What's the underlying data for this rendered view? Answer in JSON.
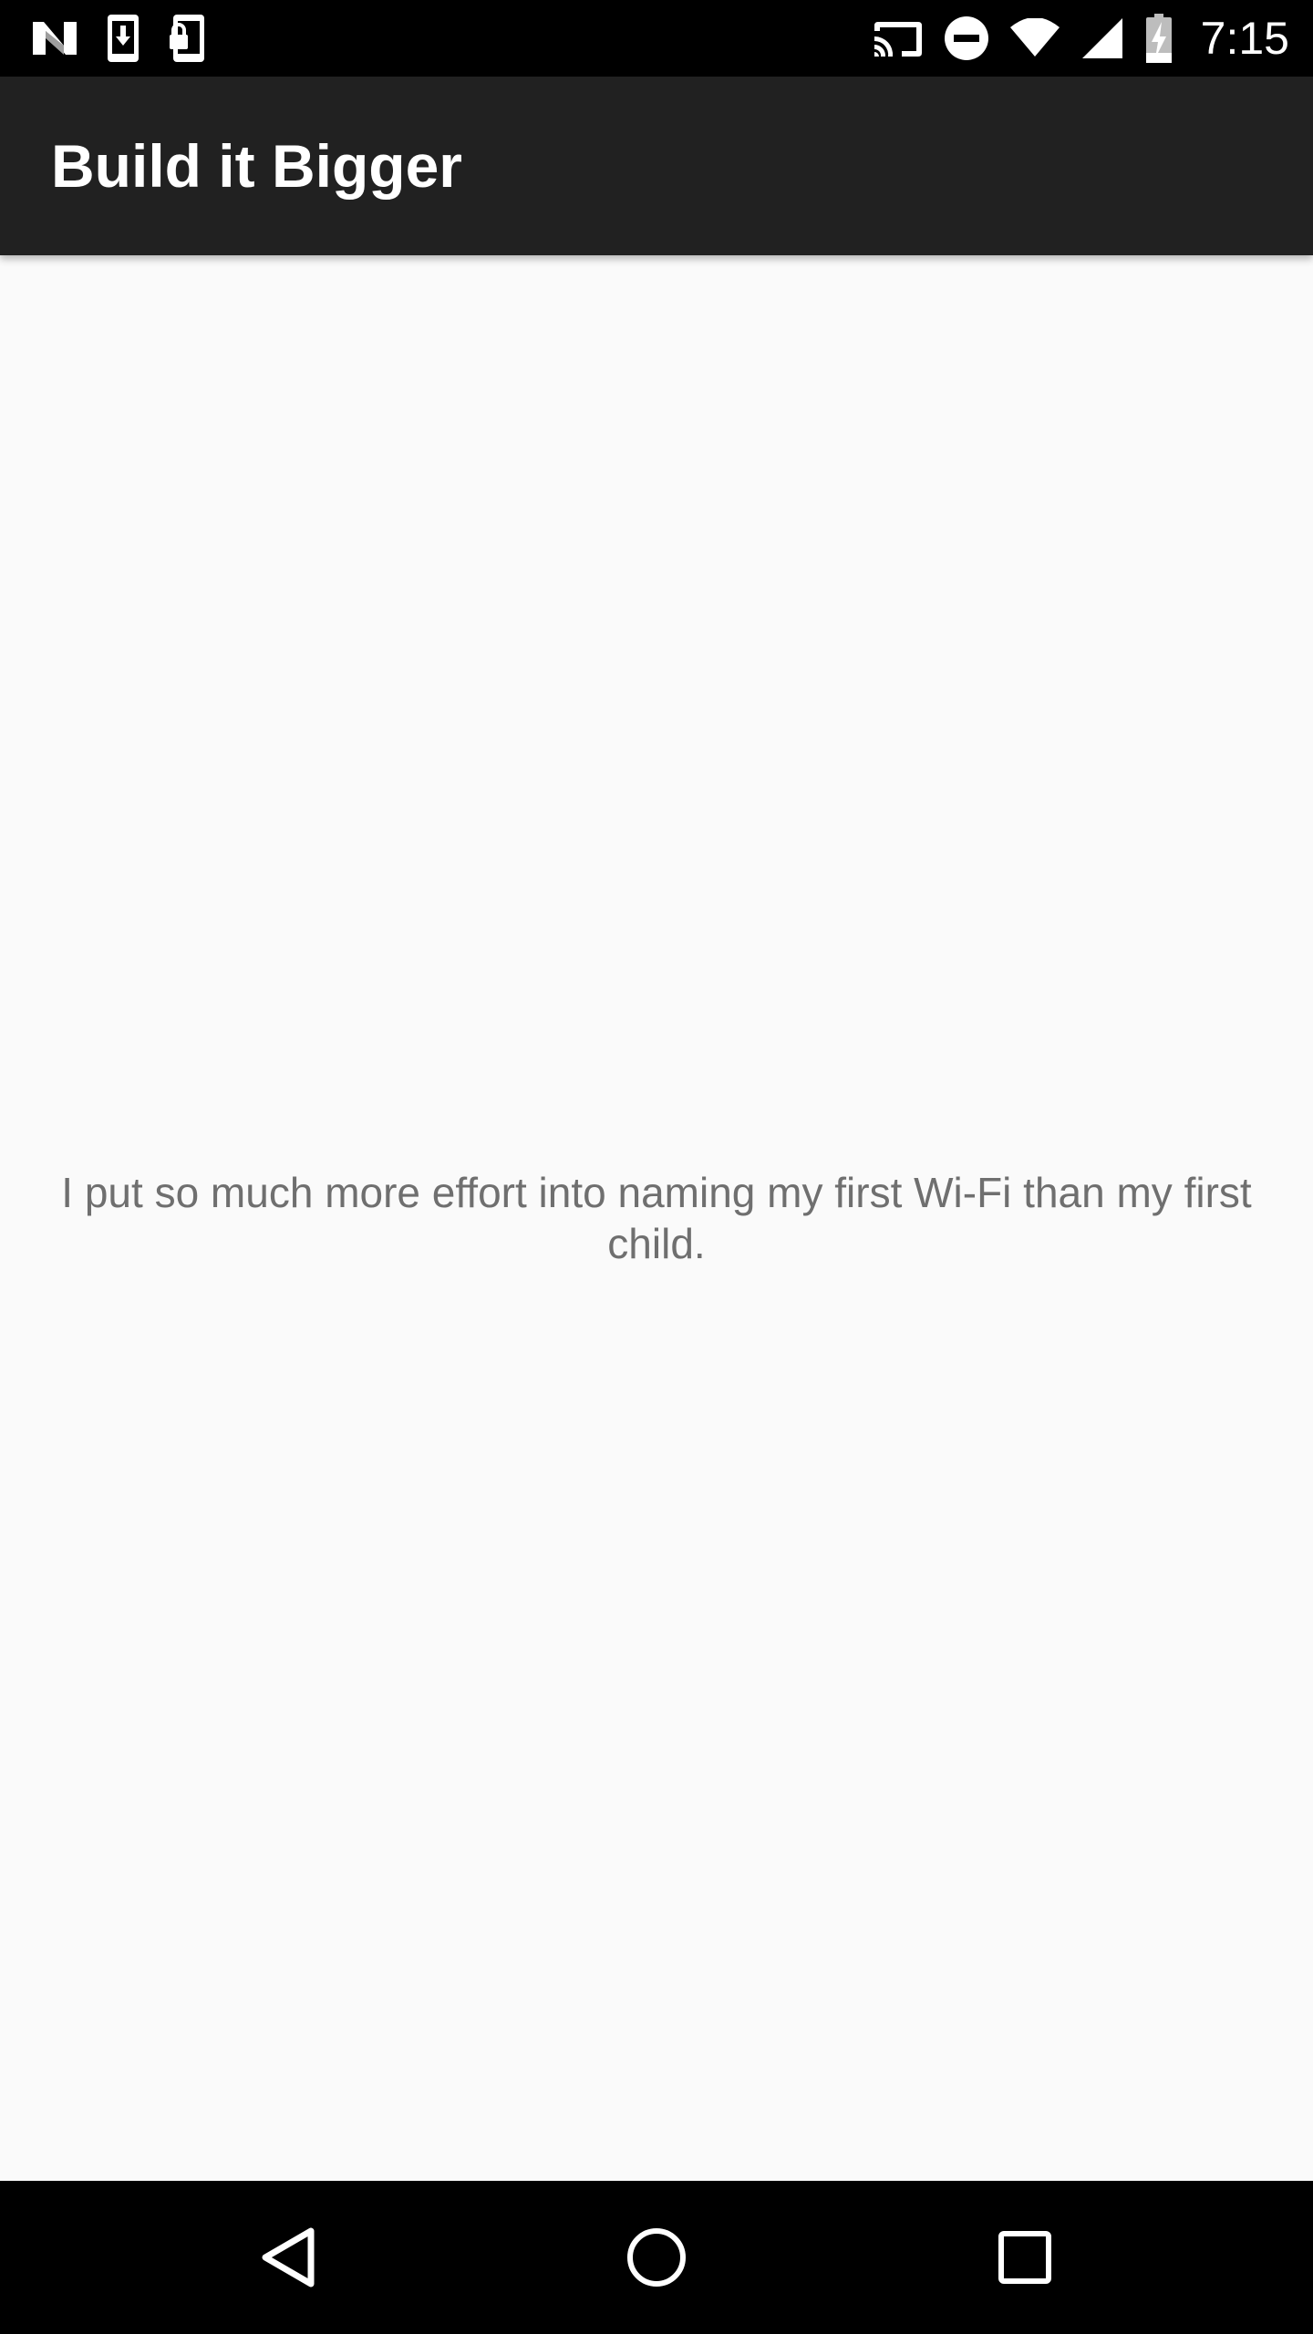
{
  "status_bar": {
    "time": "7:15",
    "left_icons": [
      "n-logo-icon",
      "download-phone-icon",
      "lock-phone-icon"
    ],
    "right_icons": [
      "cast-icon",
      "do-not-disturb-icon",
      "wifi-icon",
      "cellular-signal-icon",
      "battery-charging-icon"
    ]
  },
  "app_bar": {
    "title": "Build it Bigger",
    "background_color": "#212121"
  },
  "main": {
    "joke_text": "I put so much more effort into naming my first Wi-Fi than my first child."
  },
  "nav_bar": {
    "buttons": [
      "back-icon",
      "home-icon",
      "recents-icon"
    ]
  }
}
